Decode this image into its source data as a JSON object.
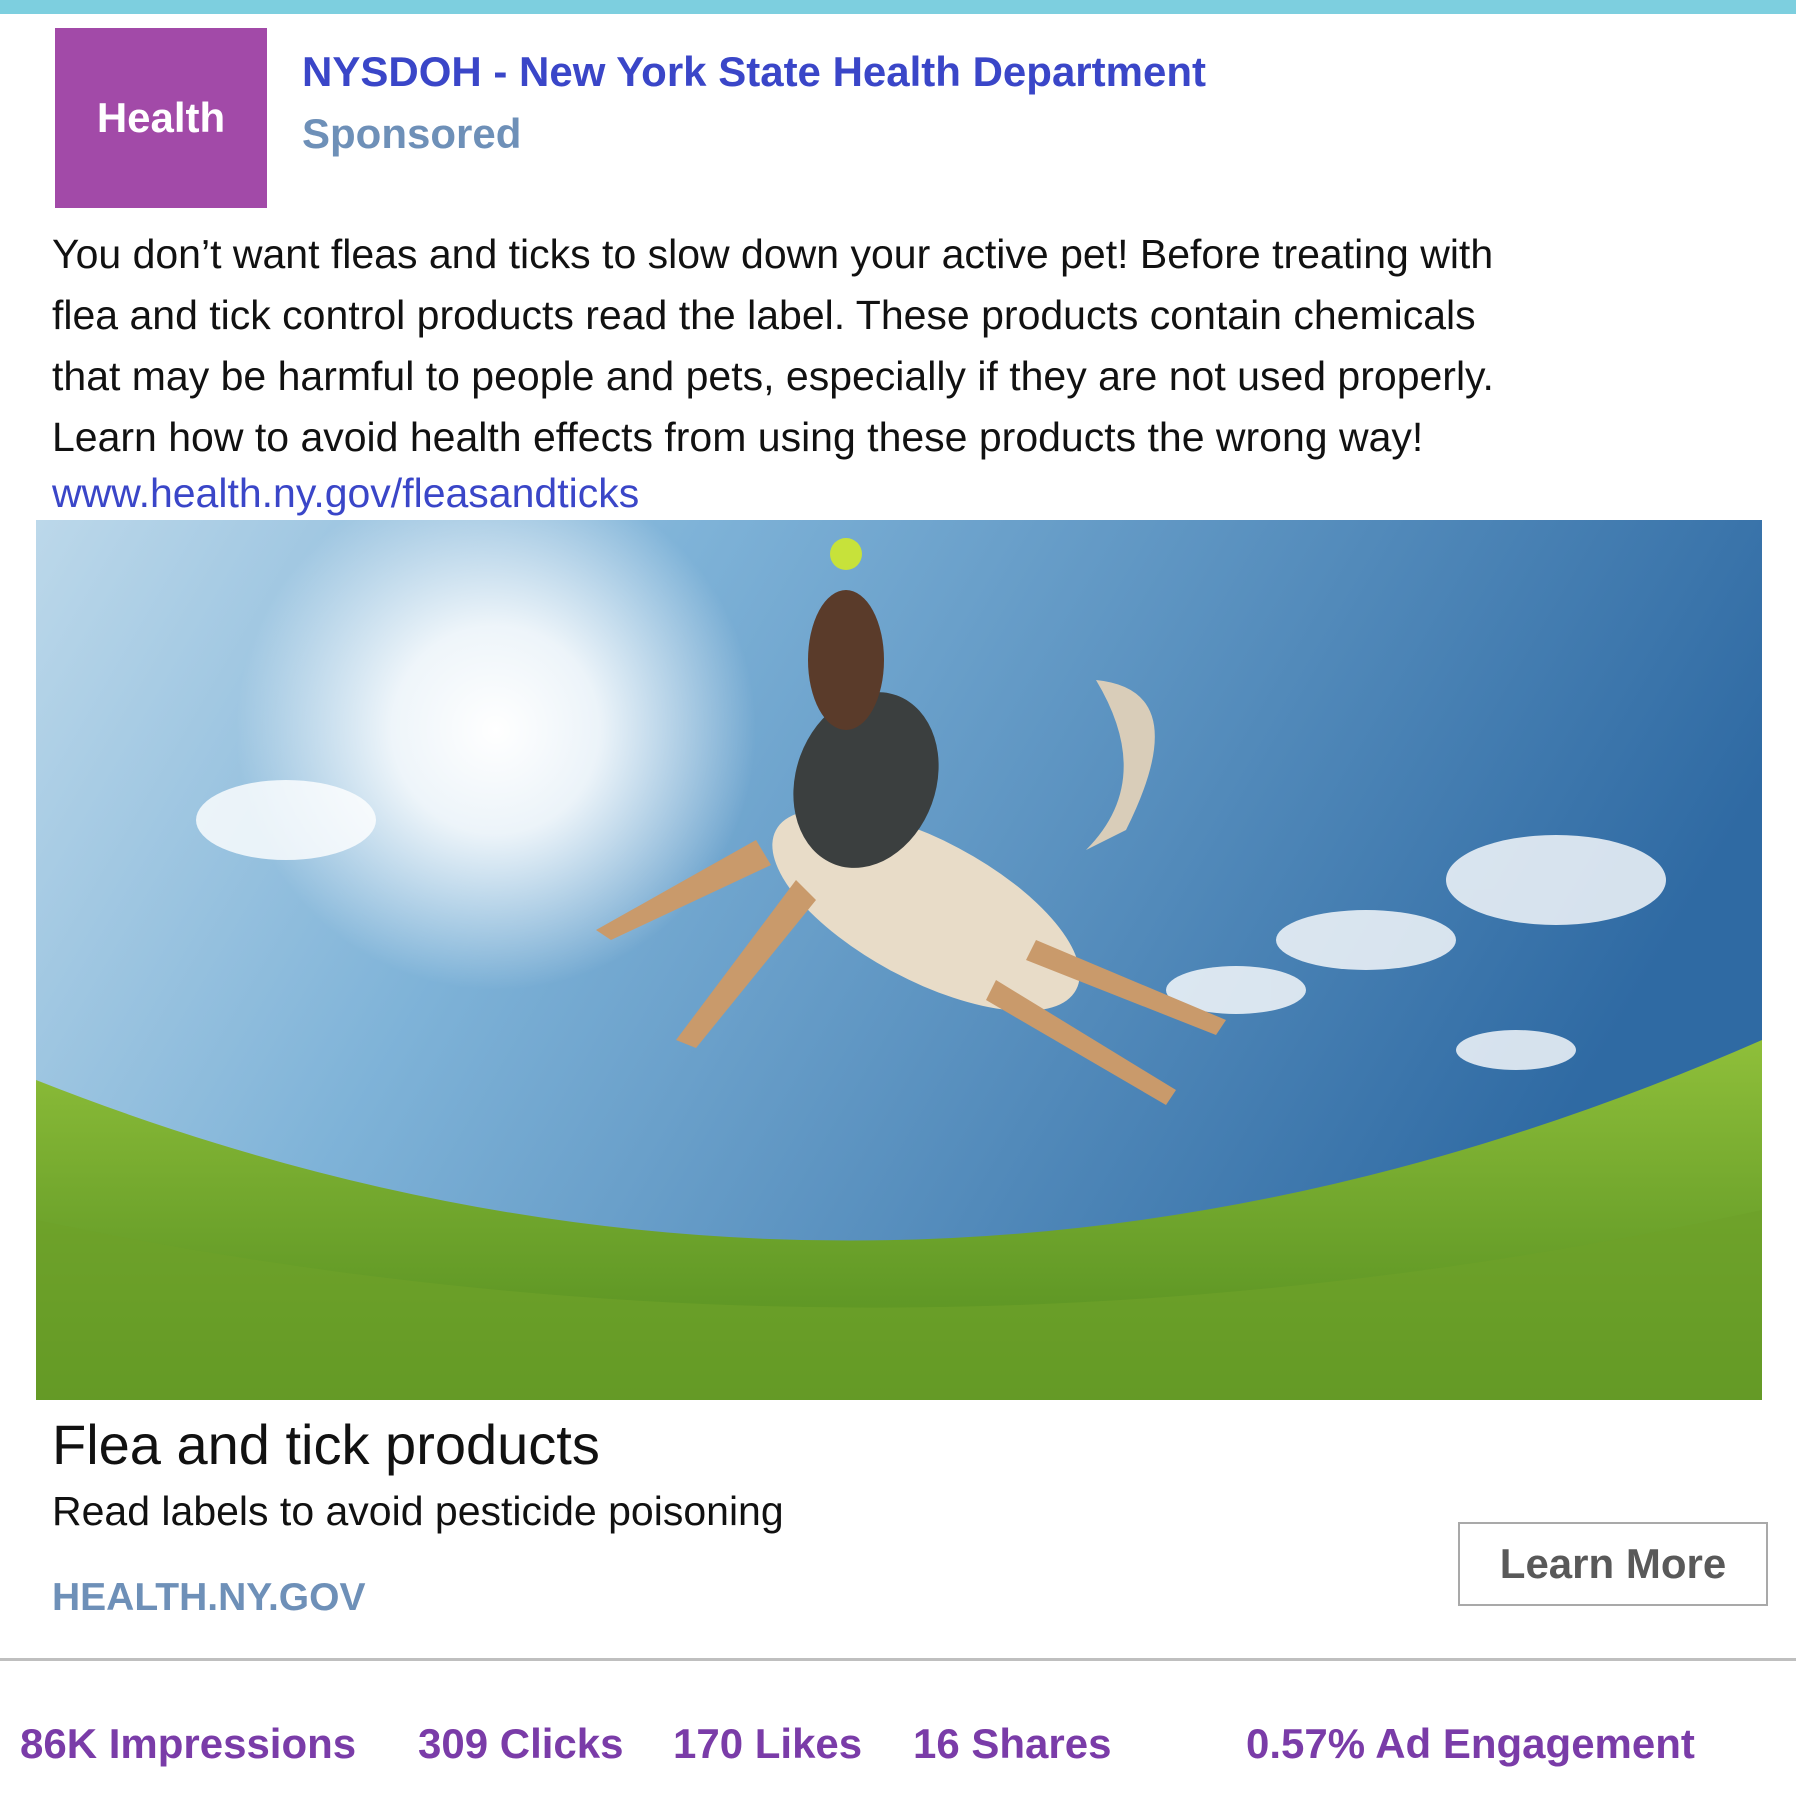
{
  "header": {
    "avatar_label": "Health",
    "page_name": "NYSDOH - New York State Health Department",
    "sponsored": "Sponsored"
  },
  "post": {
    "text_lines": [
      "You don’t want fleas and ticks to slow down your active pet! Before treating with",
      "flea and tick control products read the label.  These products contain chemicals",
      "that may be harmful to people and pets, especially if they are not used properly.",
      "Learn how to avoid health effects from using these products the wrong way!"
    ],
    "link": "www.health.ny.gov/fleasandticks"
  },
  "card": {
    "headline": "Flea and tick products",
    "subhead": "Read labels to avoid pesticide poisoning",
    "domain": "HEALTH.NY.GOV",
    "cta_label": "Learn More"
  },
  "stats": {
    "impressions": "86K Impressions",
    "clicks": "309 Clicks",
    "likes": "170 Likes",
    "shares": "16 Shares",
    "engagement": "0.57% Ad Engagement"
  },
  "colors": {
    "accent": "#7dcfdf",
    "avatar": "#a24aa8",
    "link": "#3a46c8",
    "muted": "#6e90b8",
    "stats": "#7a3ca8"
  }
}
